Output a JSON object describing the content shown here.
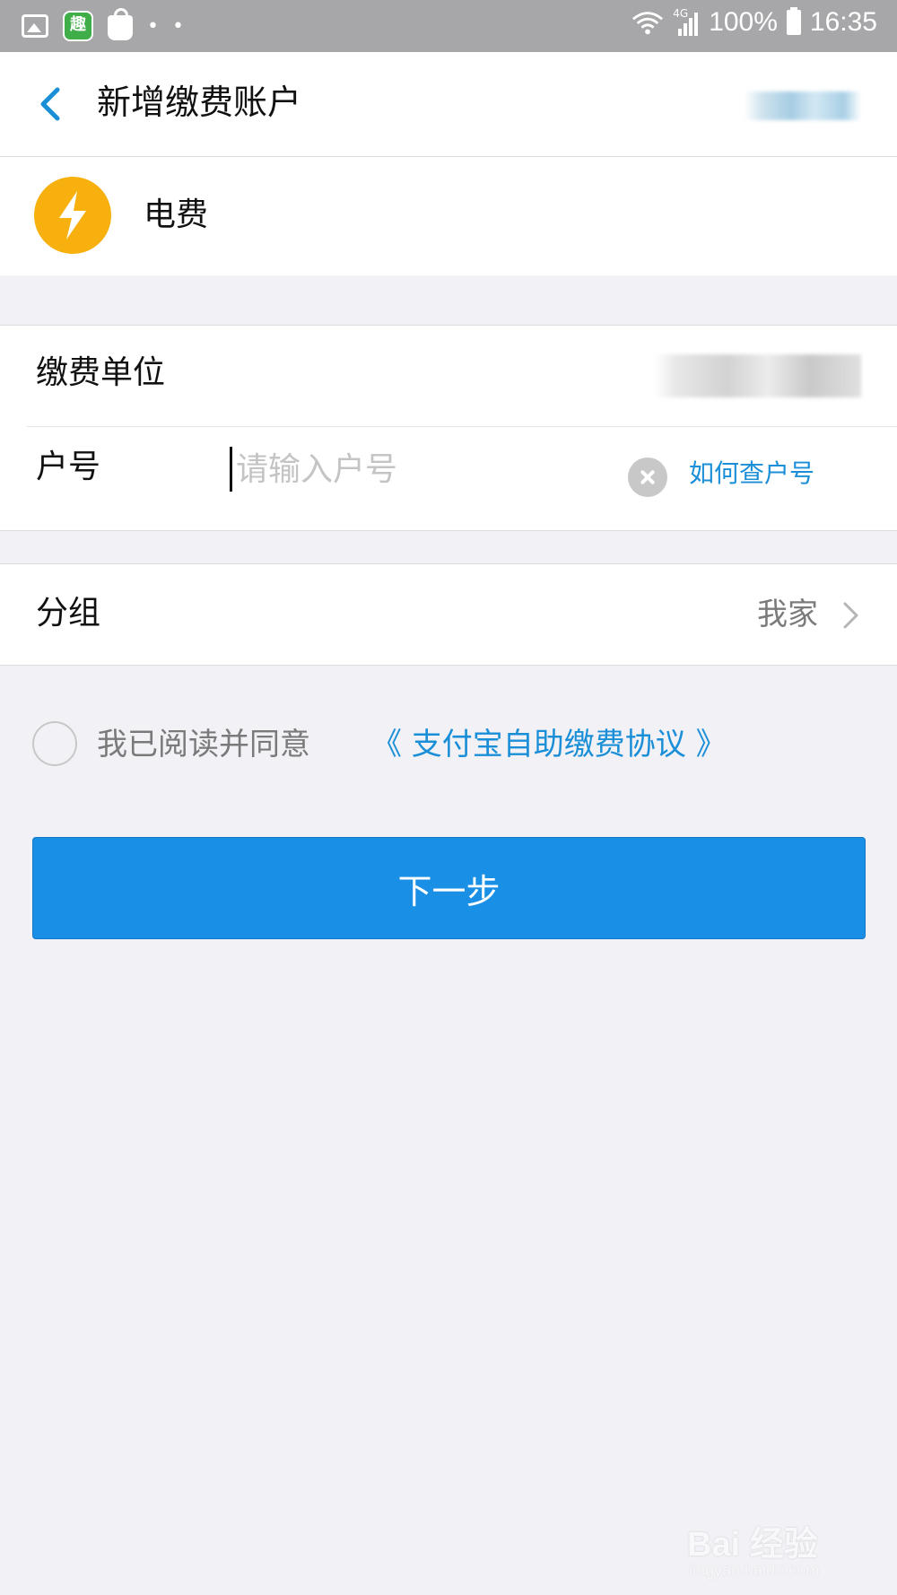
{
  "status_bar": {
    "network": "4G",
    "battery": "100%",
    "time": "16:35",
    "left_icons": [
      "gallery-icon",
      "qu-app-icon",
      "shopping-bag-icon",
      "more-dots-icon"
    ],
    "qu_label": "趣",
    "dots": "• •"
  },
  "nav": {
    "title": "新增缴费账户"
  },
  "service": {
    "name": "电费",
    "icon": "lightning-icon",
    "icon_color": "#f7b00d"
  },
  "form": {
    "unit_label": "缴费单位",
    "account_label": "户号",
    "account_value": "",
    "account_placeholder": "请输入户号",
    "how_link": "如何查户号"
  },
  "group": {
    "label": "分组",
    "value": "我家"
  },
  "agreement": {
    "checked": false,
    "text": "我已阅读并同意",
    "link": "《 支付宝自助缴费协议 》"
  },
  "next_button": {
    "label": "下一步",
    "color": "#1a8fe6"
  },
  "watermark": {
    "text": "Bai 经验",
    "sub": "jingyan.baidu.com"
  },
  "colors": {
    "accent": "#1a8fd8",
    "background": "#f1f1f6",
    "status_bar": "#a7a7a9"
  }
}
